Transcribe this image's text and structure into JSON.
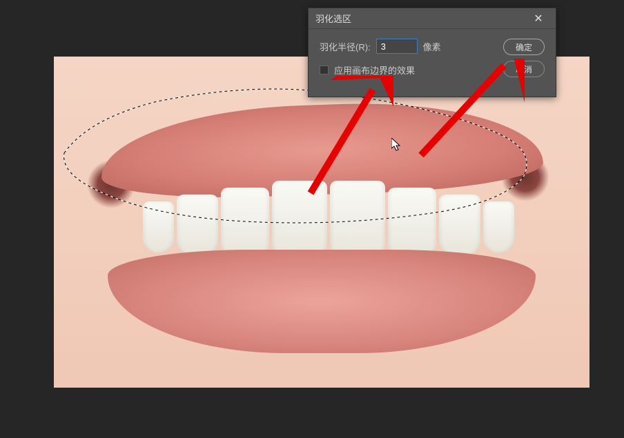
{
  "dialog": {
    "title": "羽化选区",
    "radius_label": "羽化半径(R):",
    "radius_value": "3",
    "radius_unit": "像素",
    "canvas_effect_label": "应用画布边界的效果",
    "ok_label": "确定",
    "cancel_label": "取消"
  }
}
